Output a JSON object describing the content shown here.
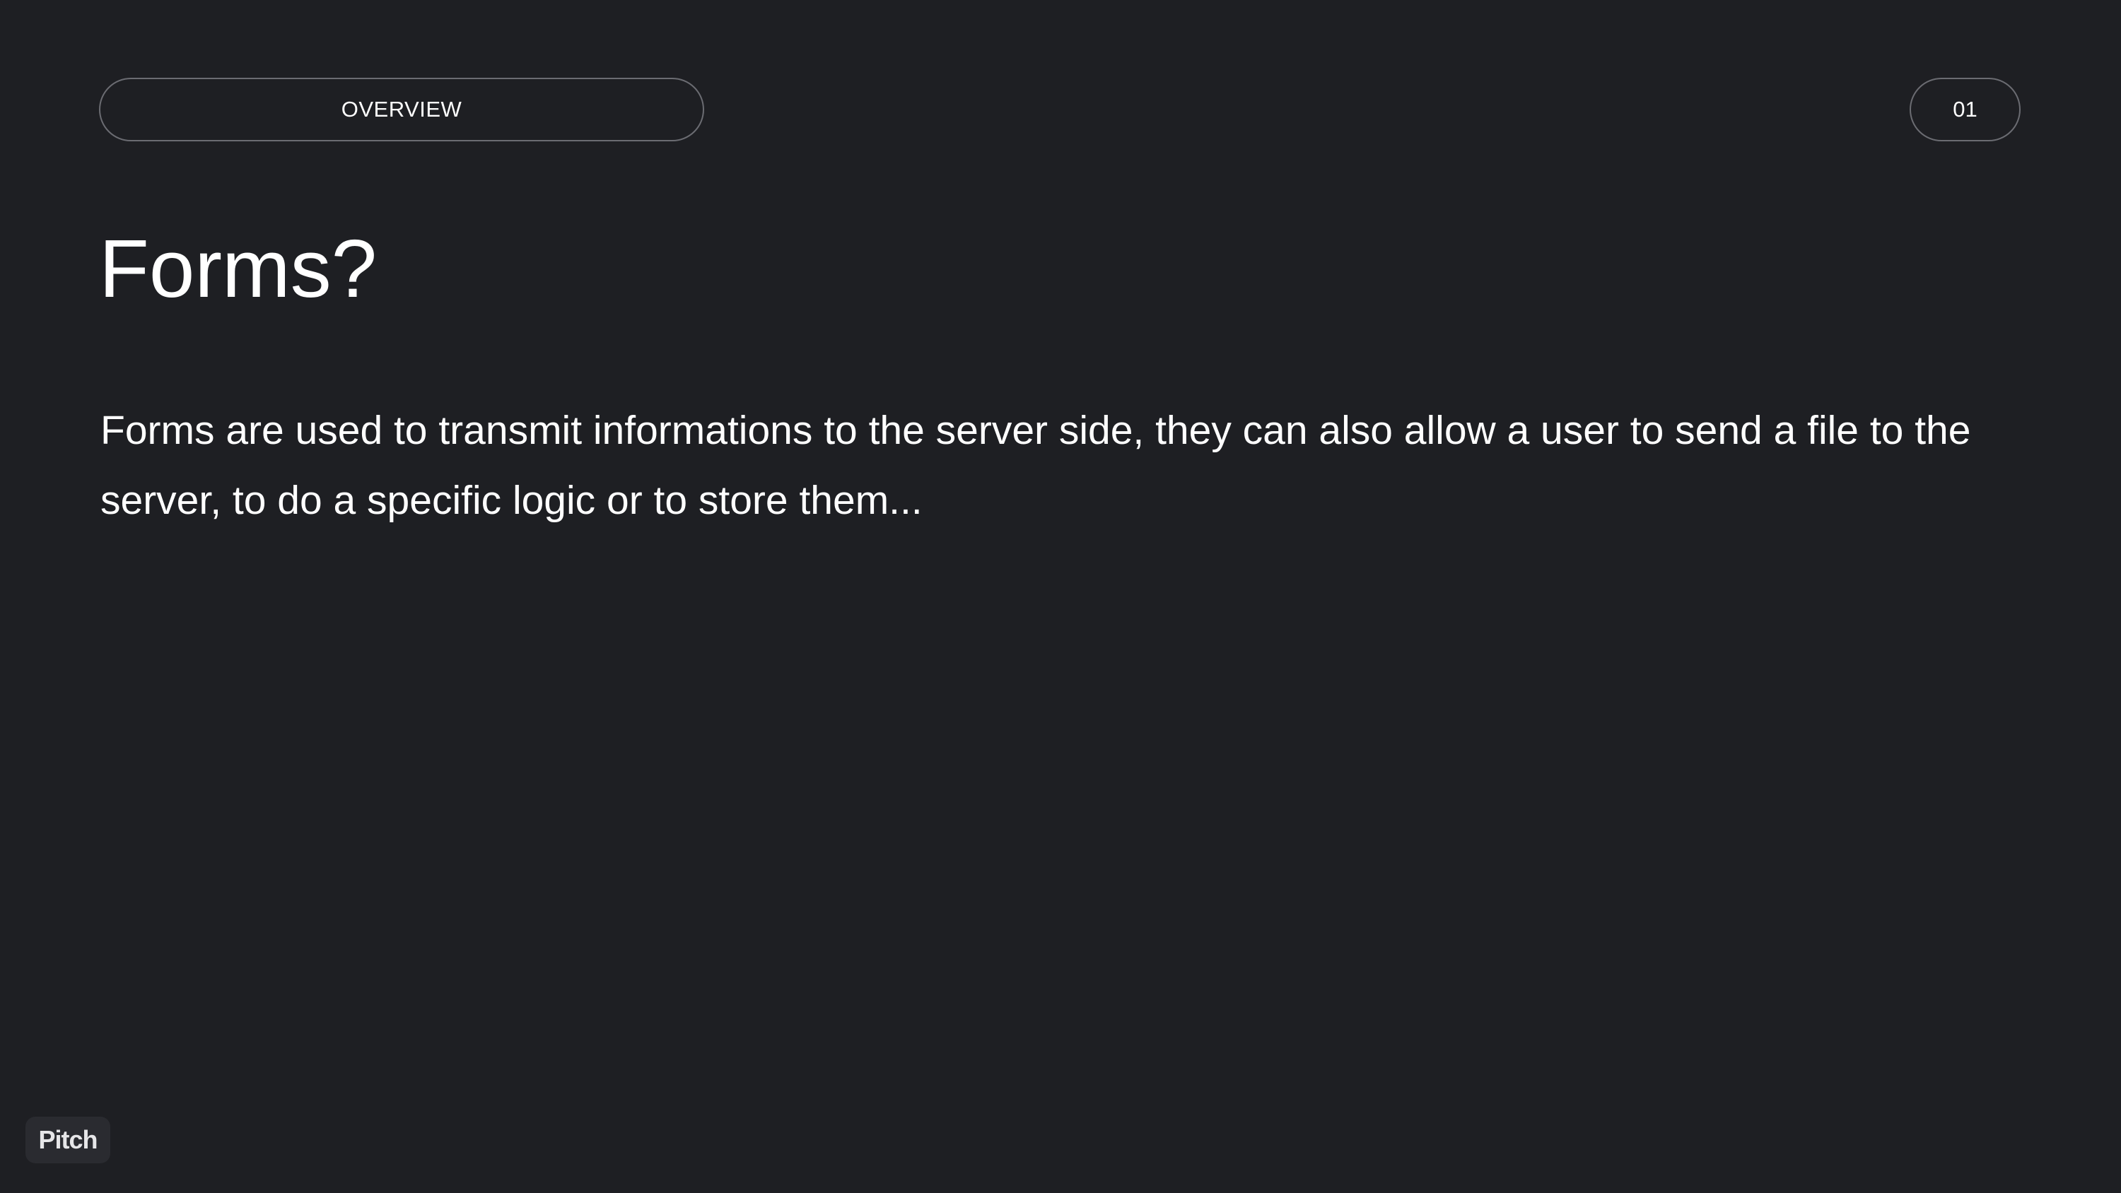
{
  "slide": {
    "section_label": "OVERVIEW",
    "page_number": "01",
    "title": "Forms?",
    "body": "Forms are used to transmit informations to the server side, they can also allow a user to send a file to the server, to do a specific logic or to store them..."
  },
  "branding": {
    "badge_text": "Pitch"
  },
  "colors": {
    "background": "#1e1f23",
    "text": "#ffffff",
    "pill_border": "#6b6c72",
    "badge_background": "#2a2b30"
  }
}
